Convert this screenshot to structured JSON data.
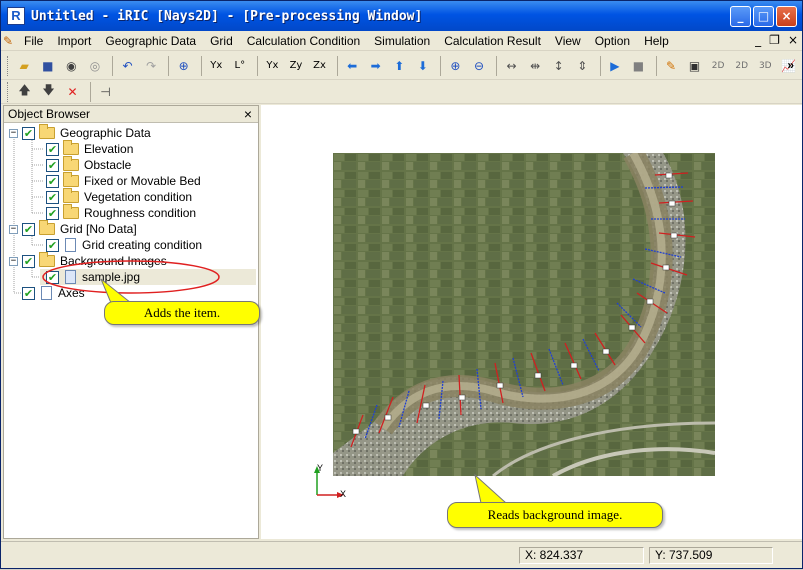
{
  "window": {
    "title": "Untitled - iRIC [Nays2D] - [Pre-processing Window]",
    "app_icon_letter": "R"
  },
  "menu": [
    "File",
    "Import",
    "Geographic Data",
    "Grid",
    "Calculation Condition",
    "Simulation",
    "Calculation Result",
    "View",
    "Option",
    "Help"
  ],
  "toolbar": {
    "overflow": "»"
  },
  "object_browser": {
    "title": "Object Browser",
    "close": "×",
    "nodes": [
      {
        "label": "Geographic Data",
        "level": 0,
        "expander": "−",
        "checked": true,
        "icon": "folder"
      },
      {
        "label": "Elevation",
        "level": 1,
        "checked": true,
        "icon": "folder"
      },
      {
        "label": "Obstacle",
        "level": 1,
        "checked": true,
        "icon": "folder"
      },
      {
        "label": "Fixed or Movable Bed",
        "level": 1,
        "checked": true,
        "icon": "folder"
      },
      {
        "label": "Vegetation condition",
        "level": 1,
        "checked": true,
        "icon": "folder"
      },
      {
        "label": "Roughness condition",
        "level": 1,
        "checked": true,
        "icon": "folder"
      },
      {
        "label": "Grid [No Data]",
        "level": 0,
        "expander": "−",
        "checked": true,
        "icon": "folder"
      },
      {
        "label": "Grid creating condition",
        "level": 1,
        "checked": true,
        "icon": "doc"
      },
      {
        "label": "Background Images",
        "level": 0,
        "expander": "−",
        "checked": true,
        "icon": "folder"
      },
      {
        "label": "sample.jpg",
        "level": 1,
        "checked": true,
        "icon": "doc-blue"
      },
      {
        "label": "Axes",
        "level": 0,
        "checked": true,
        "icon": "doc"
      }
    ]
  },
  "callouts": {
    "adds": "Adds the item.",
    "reads": "Reads background image."
  },
  "axes": {
    "x": "X",
    "y": "Y"
  },
  "status": {
    "x_readout": "X: 824.337",
    "y_readout": "Y: 737.509"
  },
  "colors": {
    "title_bar": "#0054e3",
    "highlight_ellipse": "#e02020",
    "callout_fill": "#ffff00"
  }
}
